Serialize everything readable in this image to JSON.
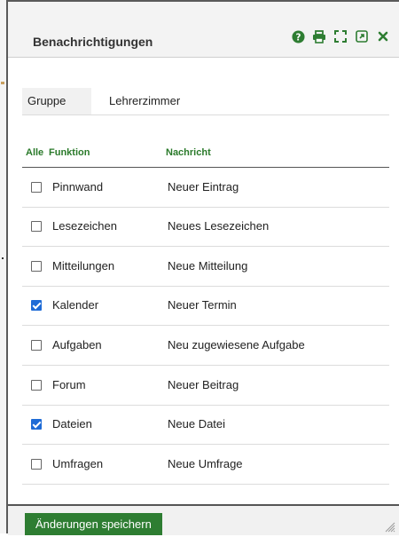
{
  "dialog": {
    "title": "Benachrichtigungen",
    "tools": [
      "help-icon",
      "print-icon",
      "expand-icon",
      "open-external-icon",
      "close-icon"
    ]
  },
  "group": {
    "label": "Gruppe",
    "value": "Lehrerzimmer"
  },
  "table": {
    "headers": {
      "all": "Alle",
      "function": "Funktion",
      "message": "Nachricht"
    },
    "rows": [
      {
        "function": "Pinnwand",
        "message": "Neuer Eintrag",
        "checked": false
      },
      {
        "function": "Lesezeichen",
        "message": "Neues Lesezeichen",
        "checked": false
      },
      {
        "function": "Mitteilungen",
        "message": "Neue Mitteilung",
        "checked": false
      },
      {
        "function": "Kalender",
        "message": "Neuer Termin",
        "checked": true
      },
      {
        "function": "Aufgaben",
        "message": "Neu zugewiesene Aufgabe",
        "checked": false
      },
      {
        "function": "Forum",
        "message": "Neuer Beitrag",
        "checked": false
      },
      {
        "function": "Dateien",
        "message": "Neue Datei",
        "checked": true
      },
      {
        "function": "Umfragen",
        "message": "Neue Umfrage",
        "checked": false
      }
    ]
  },
  "footer": {
    "save_label": "Änderungen speichern"
  },
  "colors": {
    "accent": "#2e7d32",
    "header_text": "#2a7a2a",
    "checkbox": "#1e6bd6"
  }
}
